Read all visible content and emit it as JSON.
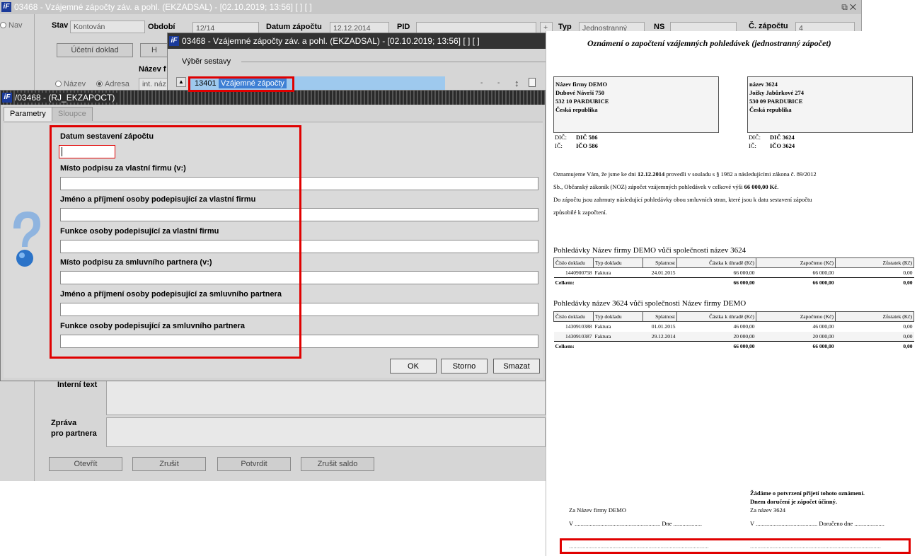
{
  "bg_window": {
    "title": "03468 - Vzájemné zápočty záv. a pohl. (EKZADSAL) - [02.10.2019; 13:56]  [ ]  [ ]",
    "nav_label": "Nav",
    "stav_label": "Stav",
    "stav_value": "Kontován",
    "obdobi_label": "Období",
    "obdobi_value": "12/14",
    "datum_label": "Datum zápočtu",
    "datum_value": "12.12.2014",
    "pid_label": "PID",
    "plus": "+",
    "typ_label": "Typ",
    "typ_value": "Jednostranný",
    "ns_label": "NS",
    "c_zapoctu_label": "Č. zápočtu",
    "c_zapoctu_value": "4",
    "ucetni_doklad": "Účetní doklad",
    "h_btn": "H",
    "nazev_f_label": "Název f",
    "radio_nazev": "Název",
    "radio_adresa": "Adresa",
    "int_naz": "int. náz",
    "interni_text": "Interní text",
    "zprava_label1": "Zpráva",
    "zprava_label2": "pro partnera",
    "buttons": [
      "Otevřít",
      "Zrušit",
      "Potvrdit",
      "Zrušit saldo"
    ]
  },
  "sest_window": {
    "title": "03468 - Vzájemné zápočty záv. a pohl. (EKZADSAL) - [02.10.2019; 13:56]  [ ]  [ ]",
    "section": "Výběr sestavy",
    "code": "13401",
    "name": "Vzájemné zápočty"
  },
  "dialog": {
    "title": "/03468 - (RJ_EKZAPOCT)",
    "tabs": [
      "Parametry",
      "Sloupce"
    ],
    "fields": [
      "Datum sestavení zápočtu",
      "Místo podpisu za vlastní firmu (v:)",
      "Jméno a příjmení osoby podepisující za vlastní firmu",
      "Funkce osoby podepisující za vlastní firmu",
      "Místo podpisu za smluvního partnera (v:)",
      "Jméno a příjmení osoby podepisující za smluvního partnera",
      "Funkce osoby podepisující za smluvního partnera"
    ],
    "ok": "OK",
    "storno": "Storno",
    "smazat": "Smazat"
  },
  "report": {
    "title": "Oznámení o započtení vzájemných pohledávek (jednostranný zápočet)",
    "own": {
      "l1": "Název firmy DEMO",
      "l2": "Dubové Návrší 750",
      "l3": "532 10 PARDUBICE",
      "l4": "Česká republika",
      "dic_l": "DIČ:",
      "dic": "DIČ 586",
      "ic_l": "IČ:",
      "ic": "IČO 586"
    },
    "partner": {
      "l1": "název 3624",
      "l2": "Jožky Jabůrkové 274",
      "l3": "530 09 PARDUBICE",
      "l4": "Česká republika",
      "dic_l": "DIČ:",
      "dic": "DIČ 3624",
      "ic_l": "IČ:",
      "ic": "IČO 3624"
    },
    "text1a": "Oznamujeme Vám, že jsme ke dni ",
    "text1b": "12.12.2014",
    "text1c": " provedli v souladu s § 1982 a následujícími zákona č. 89/2012",
    "text2a": "Sb., Občanský zákoník (NOZ) zápočet vzájemných pohledávek v celkové výši ",
    "text2b": "66 000,00 Kč",
    "text2c": ".",
    "text3": "Do zápočtu jsou zahrnuty následující pohledávky obou smluvních stran, které jsou k datu sestavení zápočtu",
    "text4": "způsobilé k započtení.",
    "sec1": "Pohledávky Název firmy DEMO vůči společnosti název 3624",
    "sec2": "Pohledávky název 3624 vůči společnosti Název firmy DEMO",
    "headers": [
      "Číslo dokladu",
      "Typ dokladu",
      "Splatnost",
      "Částka k úhradě (Kč)",
      "Započteno (Kč)",
      "Zůstatek (Kč)"
    ],
    "rows1": [
      [
        "1440900758",
        "Faktura",
        "24.01.2015",
        "66 000,00",
        "66 000,00",
        "0,00"
      ]
    ],
    "rows2": [
      [
        "1430910388",
        "Faktura",
        "01.01.2015",
        "46 000,00",
        "46 000,00",
        "0,00"
      ],
      [
        "1430910387",
        "Faktura",
        "29.12.2014",
        "20 000,00",
        "20 000,00",
        "0,00"
      ]
    ],
    "total_label": "Celkem:",
    "total1": [
      "66 000,00",
      "66 000,00",
      "0,00"
    ],
    "total2": [
      "66 000,00",
      "66 000,00",
      "0,00"
    ],
    "confirm1": "Žádáme o potvrzení přijetí tohoto oznámení.",
    "confirm2": "Dnem doručení je zápočet účinný.",
    "za_own": "Za Název firmy DEMO",
    "za_partner": "Za název 3624",
    "v_own": "V ......................................................... Dne ...................",
    "v_partner": "V ......................................... Doručeno dne ....................",
    "dots_own": ".............................................................................................",
    "dots_partner": "......................................................................................."
  }
}
